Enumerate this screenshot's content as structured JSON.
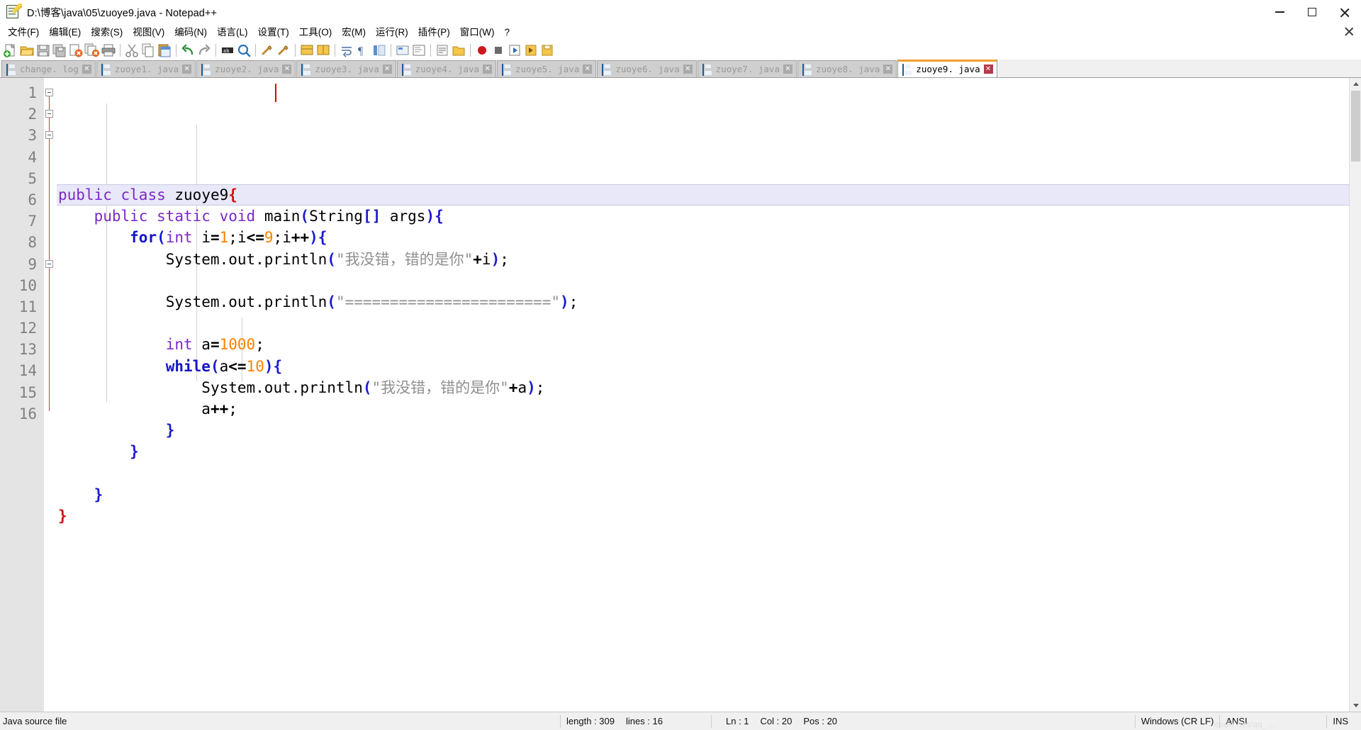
{
  "window": {
    "title": "D:\\博客\\java\\05\\zuoye9.java - Notepad++",
    "icon": "notepad-plus-plus-icon",
    "minimize_label": "–",
    "maximize_label": "□",
    "close_label": "✕"
  },
  "menubar": {
    "items": [
      {
        "label": "文件(F)",
        "name": "menu-file"
      },
      {
        "label": "编辑(E)",
        "name": "menu-edit"
      },
      {
        "label": "搜索(S)",
        "name": "menu-search"
      },
      {
        "label": "视图(V)",
        "name": "menu-view"
      },
      {
        "label": "编码(N)",
        "name": "menu-encoding"
      },
      {
        "label": "语言(L)",
        "name": "menu-language"
      },
      {
        "label": "设置(T)",
        "name": "menu-settings"
      },
      {
        "label": "工具(O)",
        "name": "menu-tools"
      },
      {
        "label": "宏(M)",
        "name": "menu-macro"
      },
      {
        "label": "运行(R)",
        "name": "menu-run"
      },
      {
        "label": "插件(P)",
        "name": "menu-plugins"
      },
      {
        "label": "窗口(W)",
        "name": "menu-window"
      },
      {
        "label": "?",
        "name": "menu-help"
      }
    ]
  },
  "toolbar": {
    "buttons": [
      "new-file-icon",
      "open-file-icon",
      "save-icon",
      "save-all-icon",
      "close-file-icon",
      "close-all-icon",
      "print-icon",
      "cut-icon",
      "copy-icon",
      "paste-icon",
      "undo-icon",
      "redo-icon",
      "find-icon",
      "replace-icon",
      "zoom-in-icon",
      "zoom-out-icon",
      "sync-vertical-scroll-icon",
      "sync-horizontal-scroll-icon",
      "word-wrap-icon",
      "show-all-chars-icon",
      "indent-guide-icon",
      "user-defined-dialog-icon",
      "document-map-icon",
      "function-list-icon",
      "folder-as-workspace-icon",
      "macro-record-icon",
      "macro-stop-icon",
      "macro-play-icon",
      "macro-playback-multiple-icon",
      "macro-save-icon"
    ]
  },
  "tabs": [
    {
      "label": "change. log",
      "active": false,
      "name": "tab-change-log"
    },
    {
      "label": "zuoye1. java",
      "active": false,
      "name": "tab-zuoye1"
    },
    {
      "label": "zuoye2. java",
      "active": false,
      "name": "tab-zuoye2"
    },
    {
      "label": "zuoye3. java",
      "active": false,
      "name": "tab-zuoye3"
    },
    {
      "label": "zuoye4. java",
      "active": false,
      "name": "tab-zuoye4"
    },
    {
      "label": "zuoye5. java",
      "active": false,
      "name": "tab-zuoye5"
    },
    {
      "label": "zuoye6. java",
      "active": false,
      "name": "tab-zuoye6"
    },
    {
      "label": "zuoye7. java",
      "active": false,
      "name": "tab-zuoye7"
    },
    {
      "label": "zuoye8. java",
      "active": false,
      "name": "tab-zuoye8"
    },
    {
      "label": "zuoye9. java",
      "active": true,
      "name": "tab-zuoye9"
    }
  ],
  "editor": {
    "language": "Java",
    "line_numbers": [
      "1",
      "2",
      "3",
      "4",
      "5",
      "6",
      "7",
      "8",
      "9",
      "10",
      "11",
      "12",
      "13",
      "14",
      "15",
      "16"
    ],
    "lines": [
      {
        "n": 1,
        "current": true,
        "fold": "open",
        "tokens": [
          {
            "t": "public",
            "c": "kw"
          },
          {
            "t": " ",
            "c": "plain"
          },
          {
            "t": "class",
            "c": "kw"
          },
          {
            "t": " ",
            "c": "plain"
          },
          {
            "t": "zuoye9",
            "c": "plain"
          },
          {
            "t": "{",
            "c": "redbrace"
          }
        ]
      },
      {
        "n": 2,
        "current": false,
        "fold": "open",
        "tokens": [
          {
            "t": "    ",
            "c": "plain"
          },
          {
            "t": "public",
            "c": "kw"
          },
          {
            "t": " ",
            "c": "plain"
          },
          {
            "t": "static",
            "c": "kw"
          },
          {
            "t": " ",
            "c": "plain"
          },
          {
            "t": "void",
            "c": "kw"
          },
          {
            "t": " ",
            "c": "plain"
          },
          {
            "t": "main",
            "c": "plain"
          },
          {
            "t": "(",
            "c": "br"
          },
          {
            "t": "String",
            "c": "plain"
          },
          {
            "t": "[]",
            "c": "br"
          },
          {
            "t": " args",
            "c": "plain"
          },
          {
            "t": ")",
            "c": "br"
          },
          {
            "t": "{",
            "c": "br"
          }
        ]
      },
      {
        "n": 3,
        "current": false,
        "fold": "open",
        "tokens": [
          {
            "t": "        ",
            "c": "plain"
          },
          {
            "t": "for",
            "c": "kwb"
          },
          {
            "t": "(",
            "c": "br"
          },
          {
            "t": "int",
            "c": "kw"
          },
          {
            "t": " i",
            "c": "plain"
          },
          {
            "t": "=",
            "c": "op"
          },
          {
            "t": "1",
            "c": "num"
          },
          {
            "t": ";i",
            "c": "plain"
          },
          {
            "t": "<=",
            "c": "op"
          },
          {
            "t": "9",
            "c": "num"
          },
          {
            "t": ";i",
            "c": "plain"
          },
          {
            "t": "++",
            "c": "op"
          },
          {
            "t": ")",
            "c": "br"
          },
          {
            "t": "{",
            "c": "br"
          }
        ]
      },
      {
        "n": 4,
        "current": false,
        "fold": "none",
        "tokens": [
          {
            "t": "            ",
            "c": "plain"
          },
          {
            "t": "System.out.println",
            "c": "plain"
          },
          {
            "t": "(",
            "c": "br"
          },
          {
            "t": "\"我没错，错的是你\"",
            "c": "str"
          },
          {
            "t": "+",
            "c": "op"
          },
          {
            "t": "i",
            "c": "plain"
          },
          {
            "t": ")",
            "c": "br"
          },
          {
            "t": ";",
            "c": "plain"
          }
        ]
      },
      {
        "n": 5,
        "current": false,
        "fold": "none",
        "tokens": []
      },
      {
        "n": 6,
        "current": false,
        "fold": "none",
        "tokens": [
          {
            "t": "            ",
            "c": "plain"
          },
          {
            "t": "System.out.println",
            "c": "plain"
          },
          {
            "t": "(",
            "c": "br"
          },
          {
            "t": "\"=======================\"",
            "c": "str"
          },
          {
            "t": ")",
            "c": "br"
          },
          {
            "t": ";",
            "c": "plain"
          }
        ]
      },
      {
        "n": 7,
        "current": false,
        "fold": "none",
        "tokens": []
      },
      {
        "n": 8,
        "current": false,
        "fold": "none",
        "tokens": [
          {
            "t": "            ",
            "c": "plain"
          },
          {
            "t": "int",
            "c": "kw"
          },
          {
            "t": " a",
            "c": "plain"
          },
          {
            "t": "=",
            "c": "op"
          },
          {
            "t": "1000",
            "c": "num"
          },
          {
            "t": ";",
            "c": "plain"
          }
        ]
      },
      {
        "n": 9,
        "current": false,
        "fold": "open",
        "tokens": [
          {
            "t": "            ",
            "c": "plain"
          },
          {
            "t": "while",
            "c": "kwb"
          },
          {
            "t": "(",
            "c": "br"
          },
          {
            "t": "a",
            "c": "plain"
          },
          {
            "t": "<=",
            "c": "op"
          },
          {
            "t": "10",
            "c": "num"
          },
          {
            "t": ")",
            "c": "br"
          },
          {
            "t": "{",
            "c": "br"
          }
        ]
      },
      {
        "n": 10,
        "current": false,
        "fold": "none",
        "tokens": [
          {
            "t": "                ",
            "c": "plain"
          },
          {
            "t": "System.out.println",
            "c": "plain"
          },
          {
            "t": "(",
            "c": "br"
          },
          {
            "t": "\"我没错，错的是你\"",
            "c": "str"
          },
          {
            "t": "+",
            "c": "op"
          },
          {
            "t": "a",
            "c": "plain"
          },
          {
            "t": ")",
            "c": "br"
          },
          {
            "t": ";",
            "c": "plain"
          }
        ]
      },
      {
        "n": 11,
        "current": false,
        "fold": "none",
        "tokens": [
          {
            "t": "                ",
            "c": "plain"
          },
          {
            "t": "a",
            "c": "plain"
          },
          {
            "t": "++",
            "c": "op"
          },
          {
            "t": ";",
            "c": "plain"
          }
        ]
      },
      {
        "n": 12,
        "current": false,
        "fold": "none",
        "tokens": [
          {
            "t": "            ",
            "c": "plain"
          },
          {
            "t": "}",
            "c": "br"
          }
        ]
      },
      {
        "n": 13,
        "current": false,
        "fold": "none",
        "tokens": [
          {
            "t": "        ",
            "c": "plain"
          },
          {
            "t": "}",
            "c": "br"
          }
        ]
      },
      {
        "n": 14,
        "current": false,
        "fold": "none",
        "tokens": []
      },
      {
        "n": 15,
        "current": false,
        "fold": "none",
        "tokens": [
          {
            "t": "    ",
            "c": "plain"
          },
          {
            "t": "}",
            "c": "br"
          }
        ]
      },
      {
        "n": 16,
        "current": false,
        "fold": "none",
        "tokens": [
          {
            "t": "}",
            "c": "redbrace"
          }
        ]
      }
    ]
  },
  "statusbar": {
    "doc_type": "Java source file",
    "length_label": "length : 309",
    "lines_label": "lines : 16",
    "ln": "Ln : 1",
    "col": "Col : 20",
    "pos": "Pos : 20",
    "eol": "Windows (CR LF)",
    "encoding": "ANSI",
    "insert_mode": "INS",
    "watermark": "csdn.net/qq_..."
  },
  "colors": {
    "keyword_purple": "#7b28c8",
    "keyword_blue": "#1414c8",
    "number_orange": "#ff8000",
    "string_gray": "#8f8f8f",
    "brace_blue": "#1a1ad0",
    "brace_red": "#d01010",
    "active_tab_accent": "#f0a030",
    "current_line_bg": "#e8e8f8",
    "gutter_bg": "#e4e4e4"
  }
}
